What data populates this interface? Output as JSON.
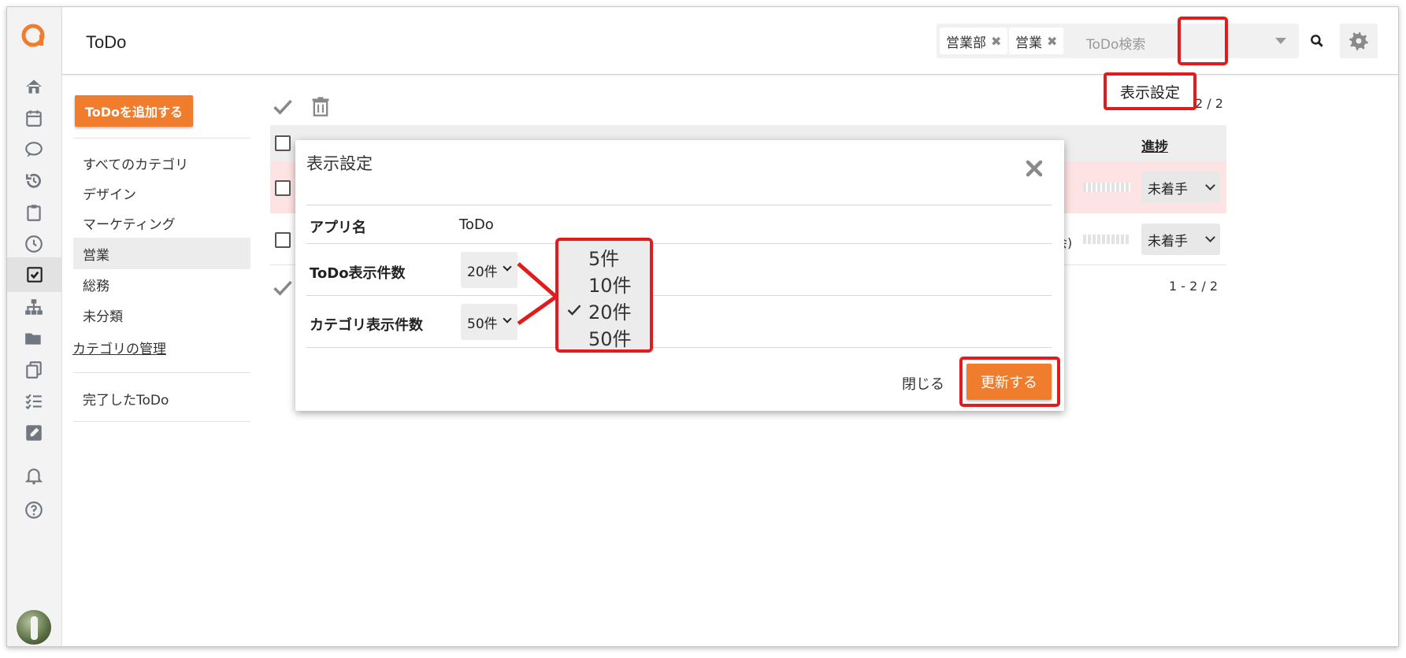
{
  "app": {
    "title": "ToDo"
  },
  "search": {
    "chips": [
      "営業部",
      "営業"
    ],
    "placeholder": "ToDo検索"
  },
  "callout": {
    "label": "表示設定"
  },
  "sidebar": {
    "add_button": "ToDoを追加する",
    "categories": [
      "すべてのカテゴリ",
      "デザイン",
      "マーケティング",
      "営業",
      "総務",
      "未分類"
    ],
    "selected": "営業",
    "manage_link": "カテゴリの管理",
    "completed_link": "完了したToDo"
  },
  "list": {
    "pager_top": "2 / 2",
    "pager_bottom": "1 - 2 / 2",
    "progress_header": "進捗",
    "rows": [
      {
        "status": "未着手",
        "highlight": true
      },
      {
        "status": "未着手",
        "fragment": "会)"
      }
    ]
  },
  "modal": {
    "title": "表示設定",
    "app_name_label": "アプリ名",
    "app_name_value": "ToDo",
    "todo_count_label": "ToDo表示件数",
    "todo_count_value": "20件",
    "category_count_label": "カテゴリ表示件数",
    "category_count_value": "50件",
    "close_label": "閉じる",
    "update_label": "更新する"
  },
  "dropdown": {
    "options": [
      "5件",
      "10件",
      "20件",
      "50件"
    ],
    "selected": "20件"
  },
  "colors": {
    "accent": "#f07c2e",
    "highlight": "#e21c1c",
    "row_overdue": "#fde3e3"
  }
}
